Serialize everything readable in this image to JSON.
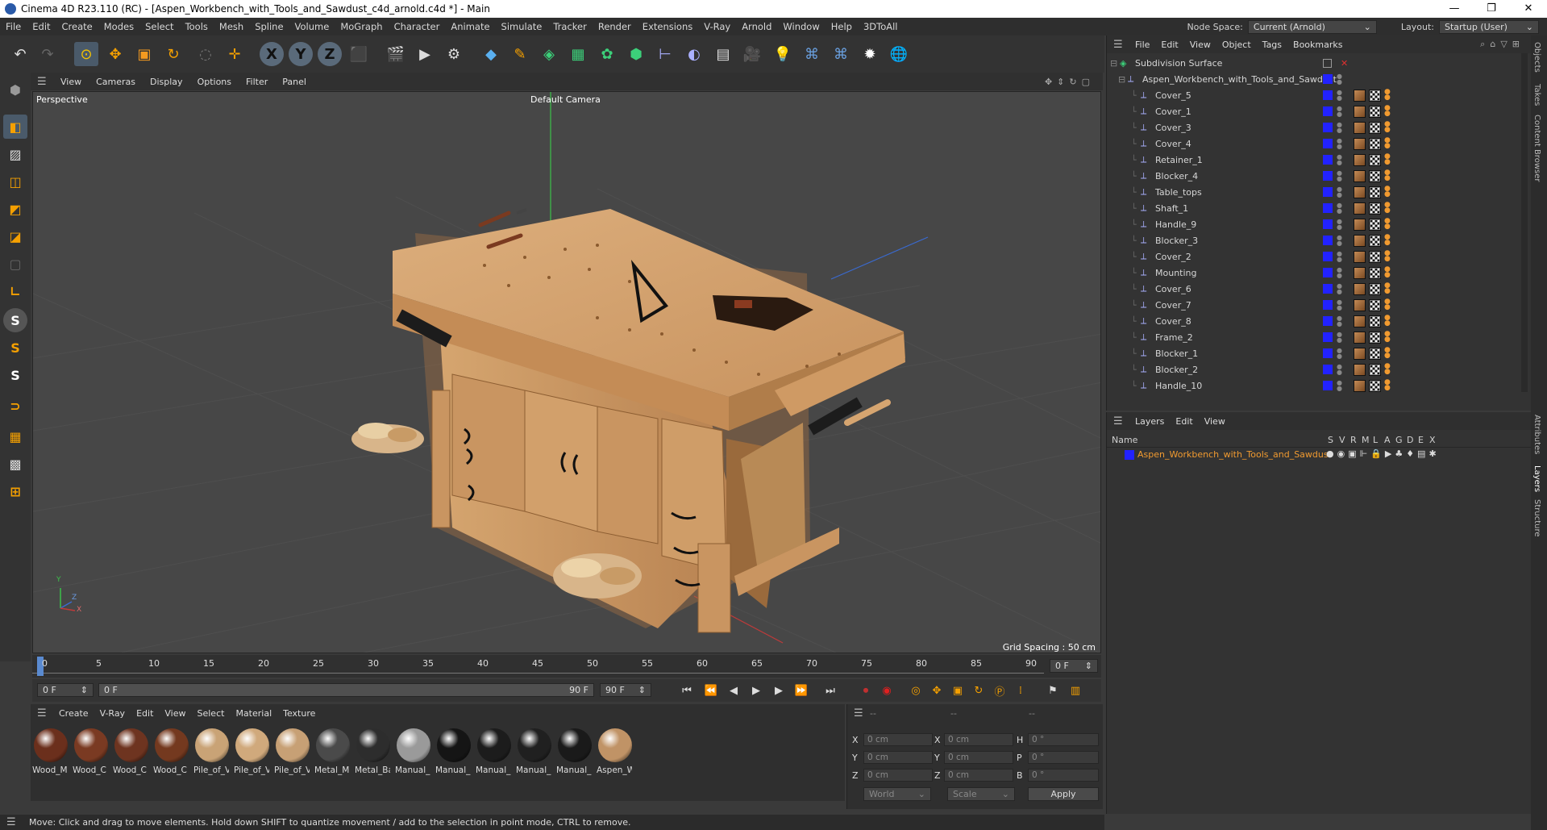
{
  "window": {
    "title": "Cinema 4D R23.110 (RC) - [Aspen_Workbench_with_Tools_and_Sawdust_c4d_arnold.c4d *] - Main",
    "minimize": "—",
    "maximize": "❐",
    "close": "✕"
  },
  "menubar": {
    "items": [
      "File",
      "Edit",
      "Create",
      "Modes",
      "Select",
      "Tools",
      "Mesh",
      "Spline",
      "Volume",
      "MoGraph",
      "Character",
      "Animate",
      "Simulate",
      "Tracker",
      "Render",
      "Extensions",
      "V-Ray",
      "Arnold",
      "Window",
      "Help",
      "3DToAll"
    ],
    "node_space_label": "Node Space:",
    "node_space_value": "Current (Arnold)",
    "layout_label": "Layout:",
    "layout_value": "Startup (User)"
  },
  "viewport": {
    "menu": [
      "View",
      "Cameras",
      "Display",
      "Options",
      "Filter",
      "Panel"
    ],
    "view_name": "Perspective",
    "camera_name": "Default Camera",
    "grid_spacing": "Grid Spacing : 50 cm",
    "axis_y": "Y",
    "axis_z": "Z",
    "axis_x": "X"
  },
  "timeline": {
    "ticks": [
      "0",
      "5",
      "10",
      "15",
      "20",
      "25",
      "30",
      "35",
      "40",
      "45",
      "50",
      "55",
      "60",
      "65",
      "70",
      "75",
      "80",
      "85",
      "90"
    ],
    "current_frame": "0 F"
  },
  "playbar": {
    "start": "0 F",
    "range_start": "0 F",
    "range_end": "90 F",
    "end": "90 F"
  },
  "materials": {
    "menu": [
      "Create",
      "V-Ray",
      "Edit",
      "View",
      "Select",
      "Material",
      "Texture"
    ],
    "items": [
      {
        "name": "Wood_M",
        "color": "#6b2f1c"
      },
      {
        "name": "Wood_C",
        "color": "#7a3a22"
      },
      {
        "name": "Wood_C",
        "color": "#6e3420"
      },
      {
        "name": "Wood_C",
        "color": "#74391f"
      },
      {
        "name": "Pile_of_V",
        "color": "#c9a376"
      },
      {
        "name": "Pile_of_V",
        "color": "#d0a97c"
      },
      {
        "name": "Pile_of_V",
        "color": "#c7a075"
      },
      {
        "name": "Metal_M",
        "color": "#4a4a4a"
      },
      {
        "name": "Metal_Ba",
        "color": "#2d2d2d"
      },
      {
        "name": "Manual_",
        "color": "#9a9a9a"
      },
      {
        "name": "Manual_",
        "color": "#151515"
      },
      {
        "name": "Manual_",
        "color": "#1c1c1c"
      },
      {
        "name": "Manual_",
        "color": "#202020"
      },
      {
        "name": "Manual_",
        "color": "#1a1a1a"
      },
      {
        "name": "Aspen_W",
        "color": "#c09366"
      }
    ]
  },
  "coordinates": {
    "headers": [
      "--",
      "--",
      "--"
    ],
    "rows": [
      {
        "a1": "X",
        "v1": "0 cm",
        "a2": "X",
        "v2": "0 cm",
        "a3": "H",
        "v3": "0 °"
      },
      {
        "a1": "Y",
        "v1": "0 cm",
        "a2": "Y",
        "v2": "0 cm",
        "a3": "P",
        "v3": "0 °"
      },
      {
        "a1": "Z",
        "v1": "0 cm",
        "a2": "Z",
        "v2": "0 cm",
        "a3": "B",
        "v3": "0 °"
      }
    ],
    "space": "World",
    "mode": "Scale",
    "apply": "Apply"
  },
  "status": "Move: Click and drag to move elements. Hold down SHIFT to quantize movement / add to the selection in point mode, CTRL to remove.",
  "objects": {
    "menu": [
      "File",
      "Edit",
      "View",
      "Object",
      "Tags",
      "Bookmarks"
    ],
    "root": "Subdivision Surface",
    "group": "Aspen_Workbench_with_Tools_and_Sawdust",
    "children": [
      "Cover_5",
      "Cover_1",
      "Cover_3",
      "Cover_4",
      "Retainer_1",
      "Blocker_4",
      "Table_tops",
      "Shaft_1",
      "Handle_9",
      "Blocker_3",
      "Cover_2",
      "Mounting",
      "Cover_6",
      "Cover_7",
      "Cover_8",
      "Frame_2",
      "Blocker_1",
      "Blocker_2",
      "Handle_10"
    ]
  },
  "layers": {
    "menu": [
      "Layers",
      "Edit",
      "View"
    ],
    "columns": [
      "Name",
      "S",
      "V",
      "R",
      "M",
      "L",
      "A",
      "G",
      "D",
      "E",
      "X"
    ],
    "rows": [
      {
        "name": "Aspen_Workbench_with_Tools_and_Sawdust",
        "color": "#2222ff"
      }
    ]
  },
  "sidetabs": [
    "Objects",
    "Takes",
    "Content Browser",
    "Attributes",
    "Layers",
    "Structure"
  ]
}
